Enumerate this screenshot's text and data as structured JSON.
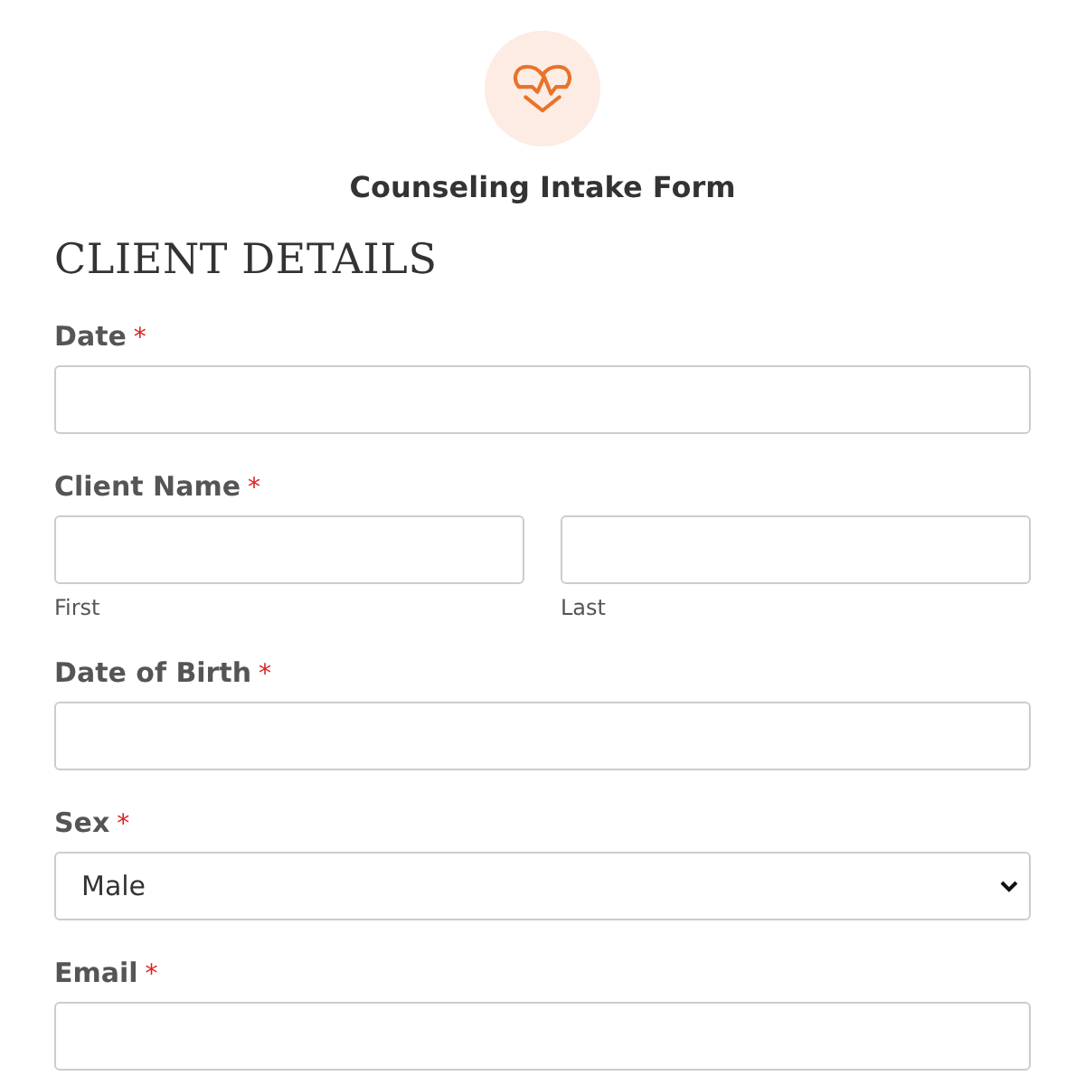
{
  "form": {
    "title": "Counseling Intake Form"
  },
  "section": {
    "heading": "CLIENT DETAILS"
  },
  "fields": [
    {
      "kind": "text",
      "label": "Date",
      "required_mark": "*"
    },
    {
      "kind": "name",
      "label": "Client Name",
      "required_mark": "*",
      "sublabels": [
        "First",
        "Last"
      ]
    },
    {
      "kind": "text",
      "label": "Date of Birth",
      "required_mark": "*"
    },
    {
      "kind": "select",
      "label": "Sex",
      "required_mark": "*",
      "value": "Male"
    },
    {
      "kind": "text",
      "label": "Email",
      "required_mark": "*"
    }
  ]
}
